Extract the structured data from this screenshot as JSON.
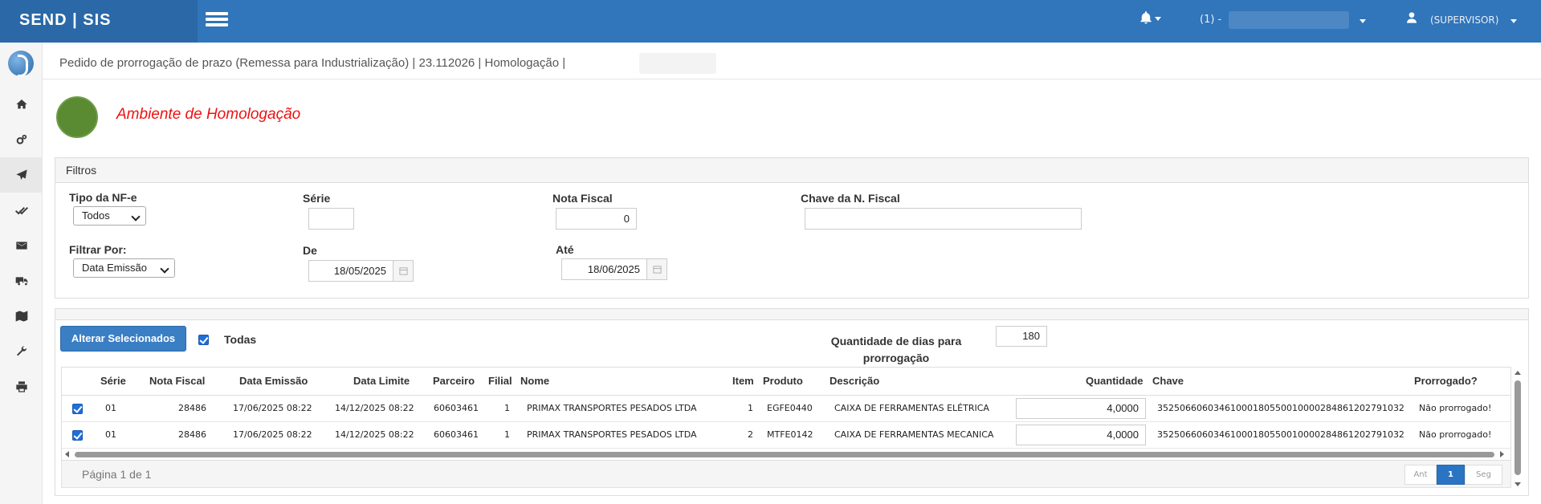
{
  "app": {
    "brand": "SEND | SIS",
    "company_prefix": "(1) -",
    "user": "(SUPERVISOR)"
  },
  "breadcrumb": "Pedido de prorrogação de prazo (Remessa para Industrialização) | 23.112026 | Homologação |",
  "environment": {
    "label": "Ambiente de Homologação",
    "indicator_color": "#5a8a32",
    "label_color": "#ee1111"
  },
  "filters": {
    "title": "Filtros",
    "tipo_nfe": {
      "label": "Tipo da NF-e",
      "value": "Todos"
    },
    "serie": {
      "label": "Série",
      "value": ""
    },
    "nota_fiscal": {
      "label": "Nota Fiscal",
      "value": "0"
    },
    "chave": {
      "label": "Chave da N. Fiscal",
      "value": ""
    },
    "filtrar_por": {
      "label": "Filtrar Por:",
      "value": "Data Emissão"
    },
    "de": {
      "label": "De",
      "value": "18/05/2025"
    },
    "ate": {
      "label": "Até",
      "value": "18/06/2025"
    }
  },
  "actions": {
    "alterar_button": "Alterar Selecionados",
    "todas_label": "Todas",
    "qtd_dias_label": "Quantidade de dias para prorrogação",
    "qtd_dias_value": "180"
  },
  "table": {
    "headers": [
      "Série",
      "Nota Fiscal",
      "Data Emissão",
      "Data Limite",
      "Parceiro",
      "Filial",
      "Nome",
      "Item",
      "Produto",
      "Descrição",
      "Quantidade",
      "Chave",
      "Prorrogado?"
    ],
    "rows": [
      {
        "checked": true,
        "serie": "01",
        "nota": "28486",
        "emissao": "17/06/2025 08:22",
        "limite": "14/12/2025 08:22",
        "parceiro": "60603461",
        "filial": "1",
        "nome": "PRIMAX TRANSPORTES PESADOS LTDA",
        "item": "1",
        "produto": "EGFE0440",
        "descricao": "CAIXA DE FERRAMENTAS ELÉTRICA",
        "quantidade": "4,0000",
        "chave": "35250660603461000180550010000284861202791032",
        "prorrogado": "Não prorrogado!"
      },
      {
        "checked": true,
        "serie": "01",
        "nota": "28486",
        "emissao": "17/06/2025 08:22",
        "limite": "14/12/2025 08:22",
        "parceiro": "60603461",
        "filial": "1",
        "nome": "PRIMAX TRANSPORTES PESADOS LTDA",
        "item": "2",
        "produto": "MTFE0142",
        "descricao": "CAIXA DE FERRAMENTAS MECANICA",
        "quantidade": "4,0000",
        "chave": "35250660603461000180550010000284861202791032",
        "prorrogado": "Não prorrogado!"
      }
    ]
  },
  "pager": {
    "info": "Página 1 de 1",
    "prev": "Ant",
    "current": "1",
    "next": "Seg"
  },
  "sidebar_icons": [
    "home-icon",
    "cogs-icon",
    "paper-plane-icon",
    "double-check-icon",
    "envelope-icon",
    "truck-icon",
    "map-icon",
    "wrench-icon",
    "print-icon"
  ]
}
